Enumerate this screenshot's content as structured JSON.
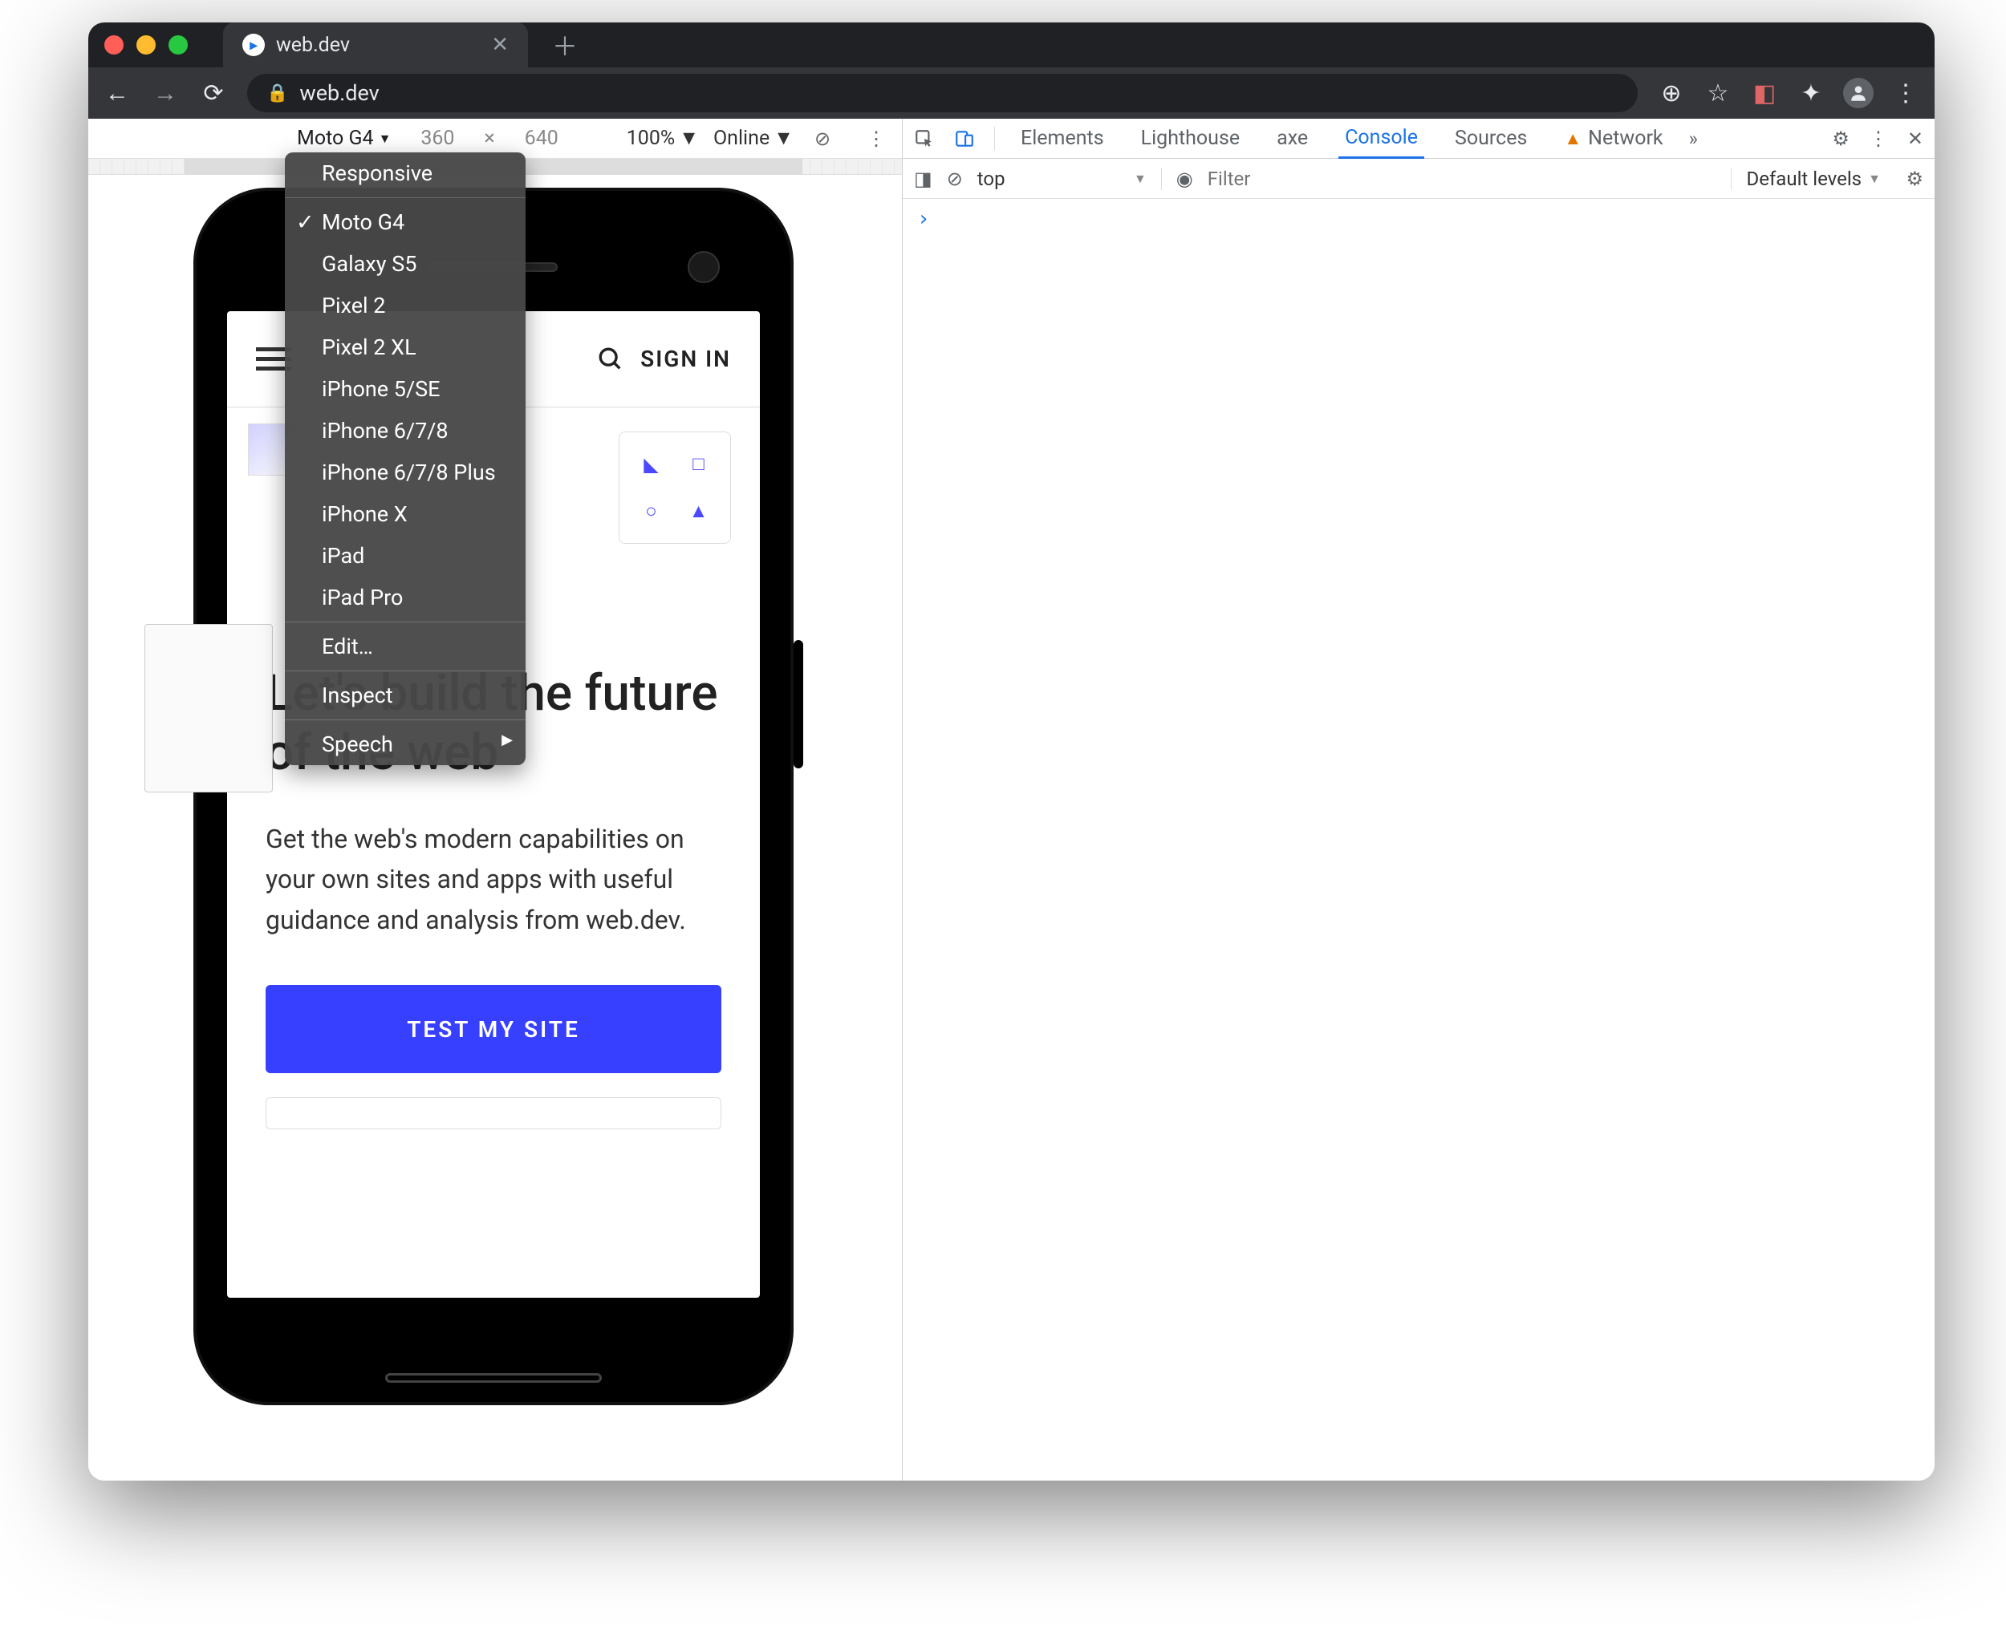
{
  "browser": {
    "tab_title": "web.dev",
    "url": "web.dev"
  },
  "device_toolbar": {
    "device": "Moto G4",
    "width": "360",
    "height": "640",
    "zoom": "100%",
    "throttle": "Online"
  },
  "device_menu": {
    "responsive": "Responsive",
    "devices": [
      "Moto G4",
      "Galaxy S5",
      "Pixel 2",
      "Pixel 2 XL",
      "iPhone 5/SE",
      "iPhone 6/7/8",
      "iPhone 6/7/8 Plus",
      "iPhone X",
      "iPad",
      "iPad Pro"
    ],
    "selected": "Moto G4",
    "edit": "Edit…",
    "inspect": "Inspect",
    "speech": "Speech"
  },
  "site": {
    "signin": "SIGN IN",
    "hero_title": "Let's build the future of the web",
    "hero_body": "Get the web's modern capabilities on your own sites and apps with useful guidance and analysis from web.dev.",
    "cta": "TEST MY SITE"
  },
  "devtools": {
    "tabs": [
      "Elements",
      "Lighthouse",
      "axe",
      "Console",
      "Sources",
      "Network"
    ],
    "active": "Console",
    "more": "»",
    "ctx": "top",
    "filter_placeholder": "Filter",
    "levels": "Default levels"
  }
}
